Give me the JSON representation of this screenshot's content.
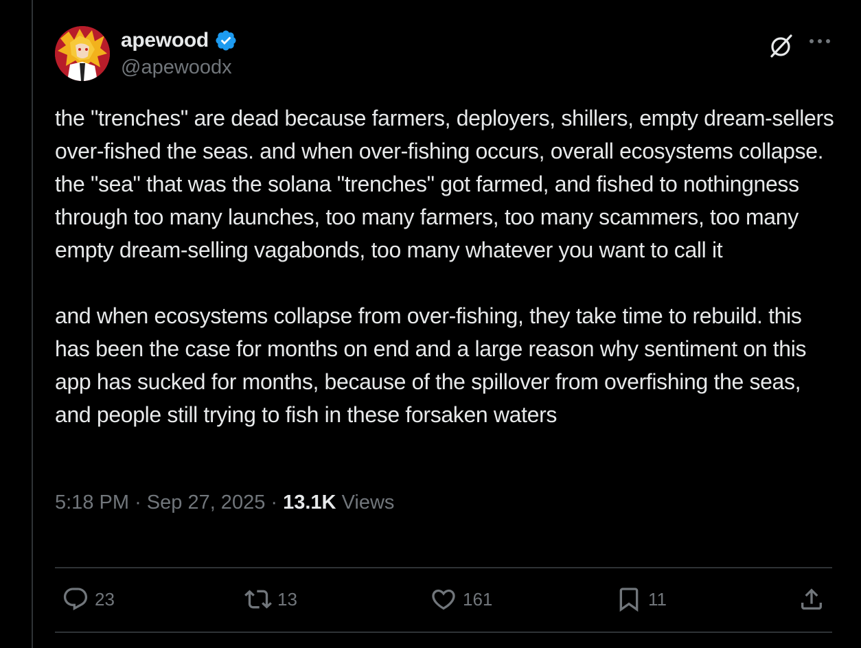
{
  "author": {
    "display_name": "apewood",
    "handle": "@apewoodx",
    "verified": true
  },
  "tweet": {
    "text": "the \"trenches\" are dead because farmers, deployers, shillers, empty dream-sellers over-fished the seas. and when over-fishing occurs, overall ecosystems collapse. the \"sea\" that was the solana \"trenches\" got farmed, and fished to nothingness through too many launches, too many farmers, too many scammers, too many empty dream-selling vagabonds, too many whatever you want to call it\n\nand when ecosystems collapse from over-fishing, they take time to rebuild. this has been the case for months on end and a large reason why sentiment on this app has sucked for months, because of the spillover from overfishing the seas, and people still trying to fish in these forsaken waters",
    "time": "5:18 PM",
    "date": "Sep 27, 2025",
    "separator": "·",
    "views_count": "13.1K",
    "views_label": "Views"
  },
  "actions": {
    "replies": "23",
    "reposts": "13",
    "likes": "161",
    "bookmarks": "11"
  },
  "colors": {
    "background": "#000000",
    "text": "#e7e9ea",
    "muted": "#71767b",
    "divider": "#2f3336",
    "verified": "#1d9bf0"
  },
  "icons": {
    "header": [
      "grok-icon",
      "more-icon"
    ],
    "actions": [
      "reply-icon",
      "repost-icon",
      "like-icon",
      "bookmark-icon",
      "share-icon"
    ]
  }
}
